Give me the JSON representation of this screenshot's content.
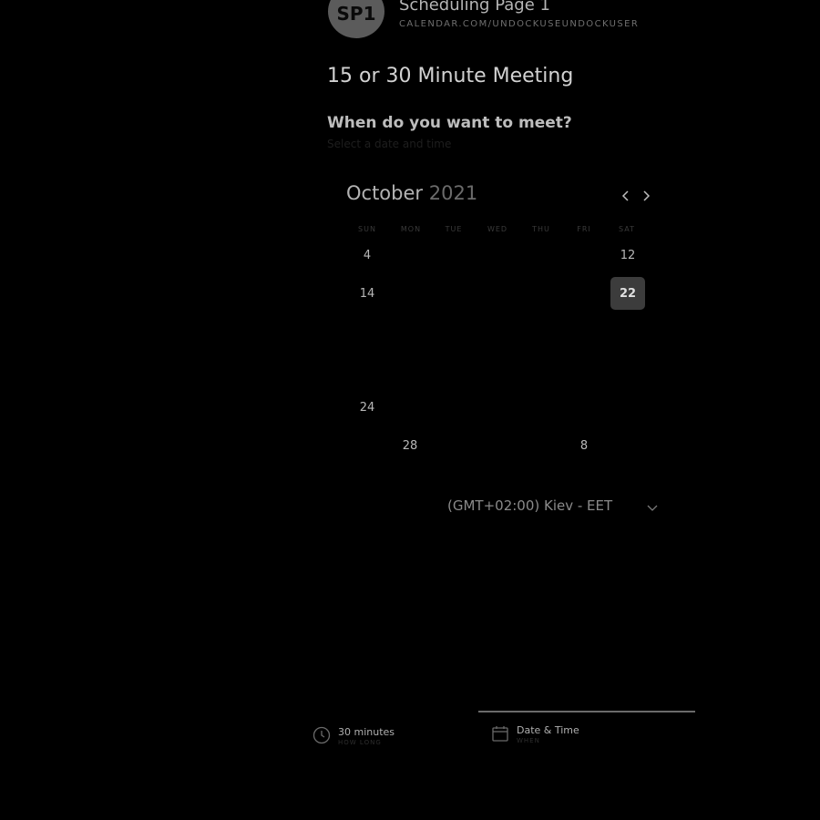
{
  "header": {
    "avatar_initials": "SP1",
    "title": "Scheduling Page 1",
    "url": "CALENDAR.COM/UNDOCKUSEUNDOCKUSER"
  },
  "meeting": {
    "title": "15 or 30 Minute Meeting",
    "question": "When do you want to meet?",
    "hint": "Select a date and time"
  },
  "calendar": {
    "month": "October",
    "year": "2021",
    "prev_icon": "chevron-left-icon",
    "next_icon": "chevron-right-icon",
    "weekdays": [
      "SUN",
      "MON",
      "TUE",
      "WED",
      "THU",
      "FRI",
      "SAT"
    ],
    "days": {
      "d4": "4",
      "d12": "12",
      "d14": "14",
      "d22": "22",
      "d24": "24",
      "d28": "28",
      "d8": "8"
    },
    "selected_day": "22"
  },
  "timezone": {
    "value": "(GMT+02:00) Kiev - EET",
    "icon": "chevron-down-icon"
  },
  "steps": [
    {
      "label": "30 minutes",
      "sub": "HOW LONG",
      "icon": "clock-icon"
    },
    {
      "label": "Date & Time",
      "sub": "WHEN",
      "icon": "calendar-icon"
    }
  ],
  "colors": {
    "background": "#000000",
    "selected_day_bg": "#3c3c3c",
    "avatar_bg": "#5b5b5b"
  }
}
